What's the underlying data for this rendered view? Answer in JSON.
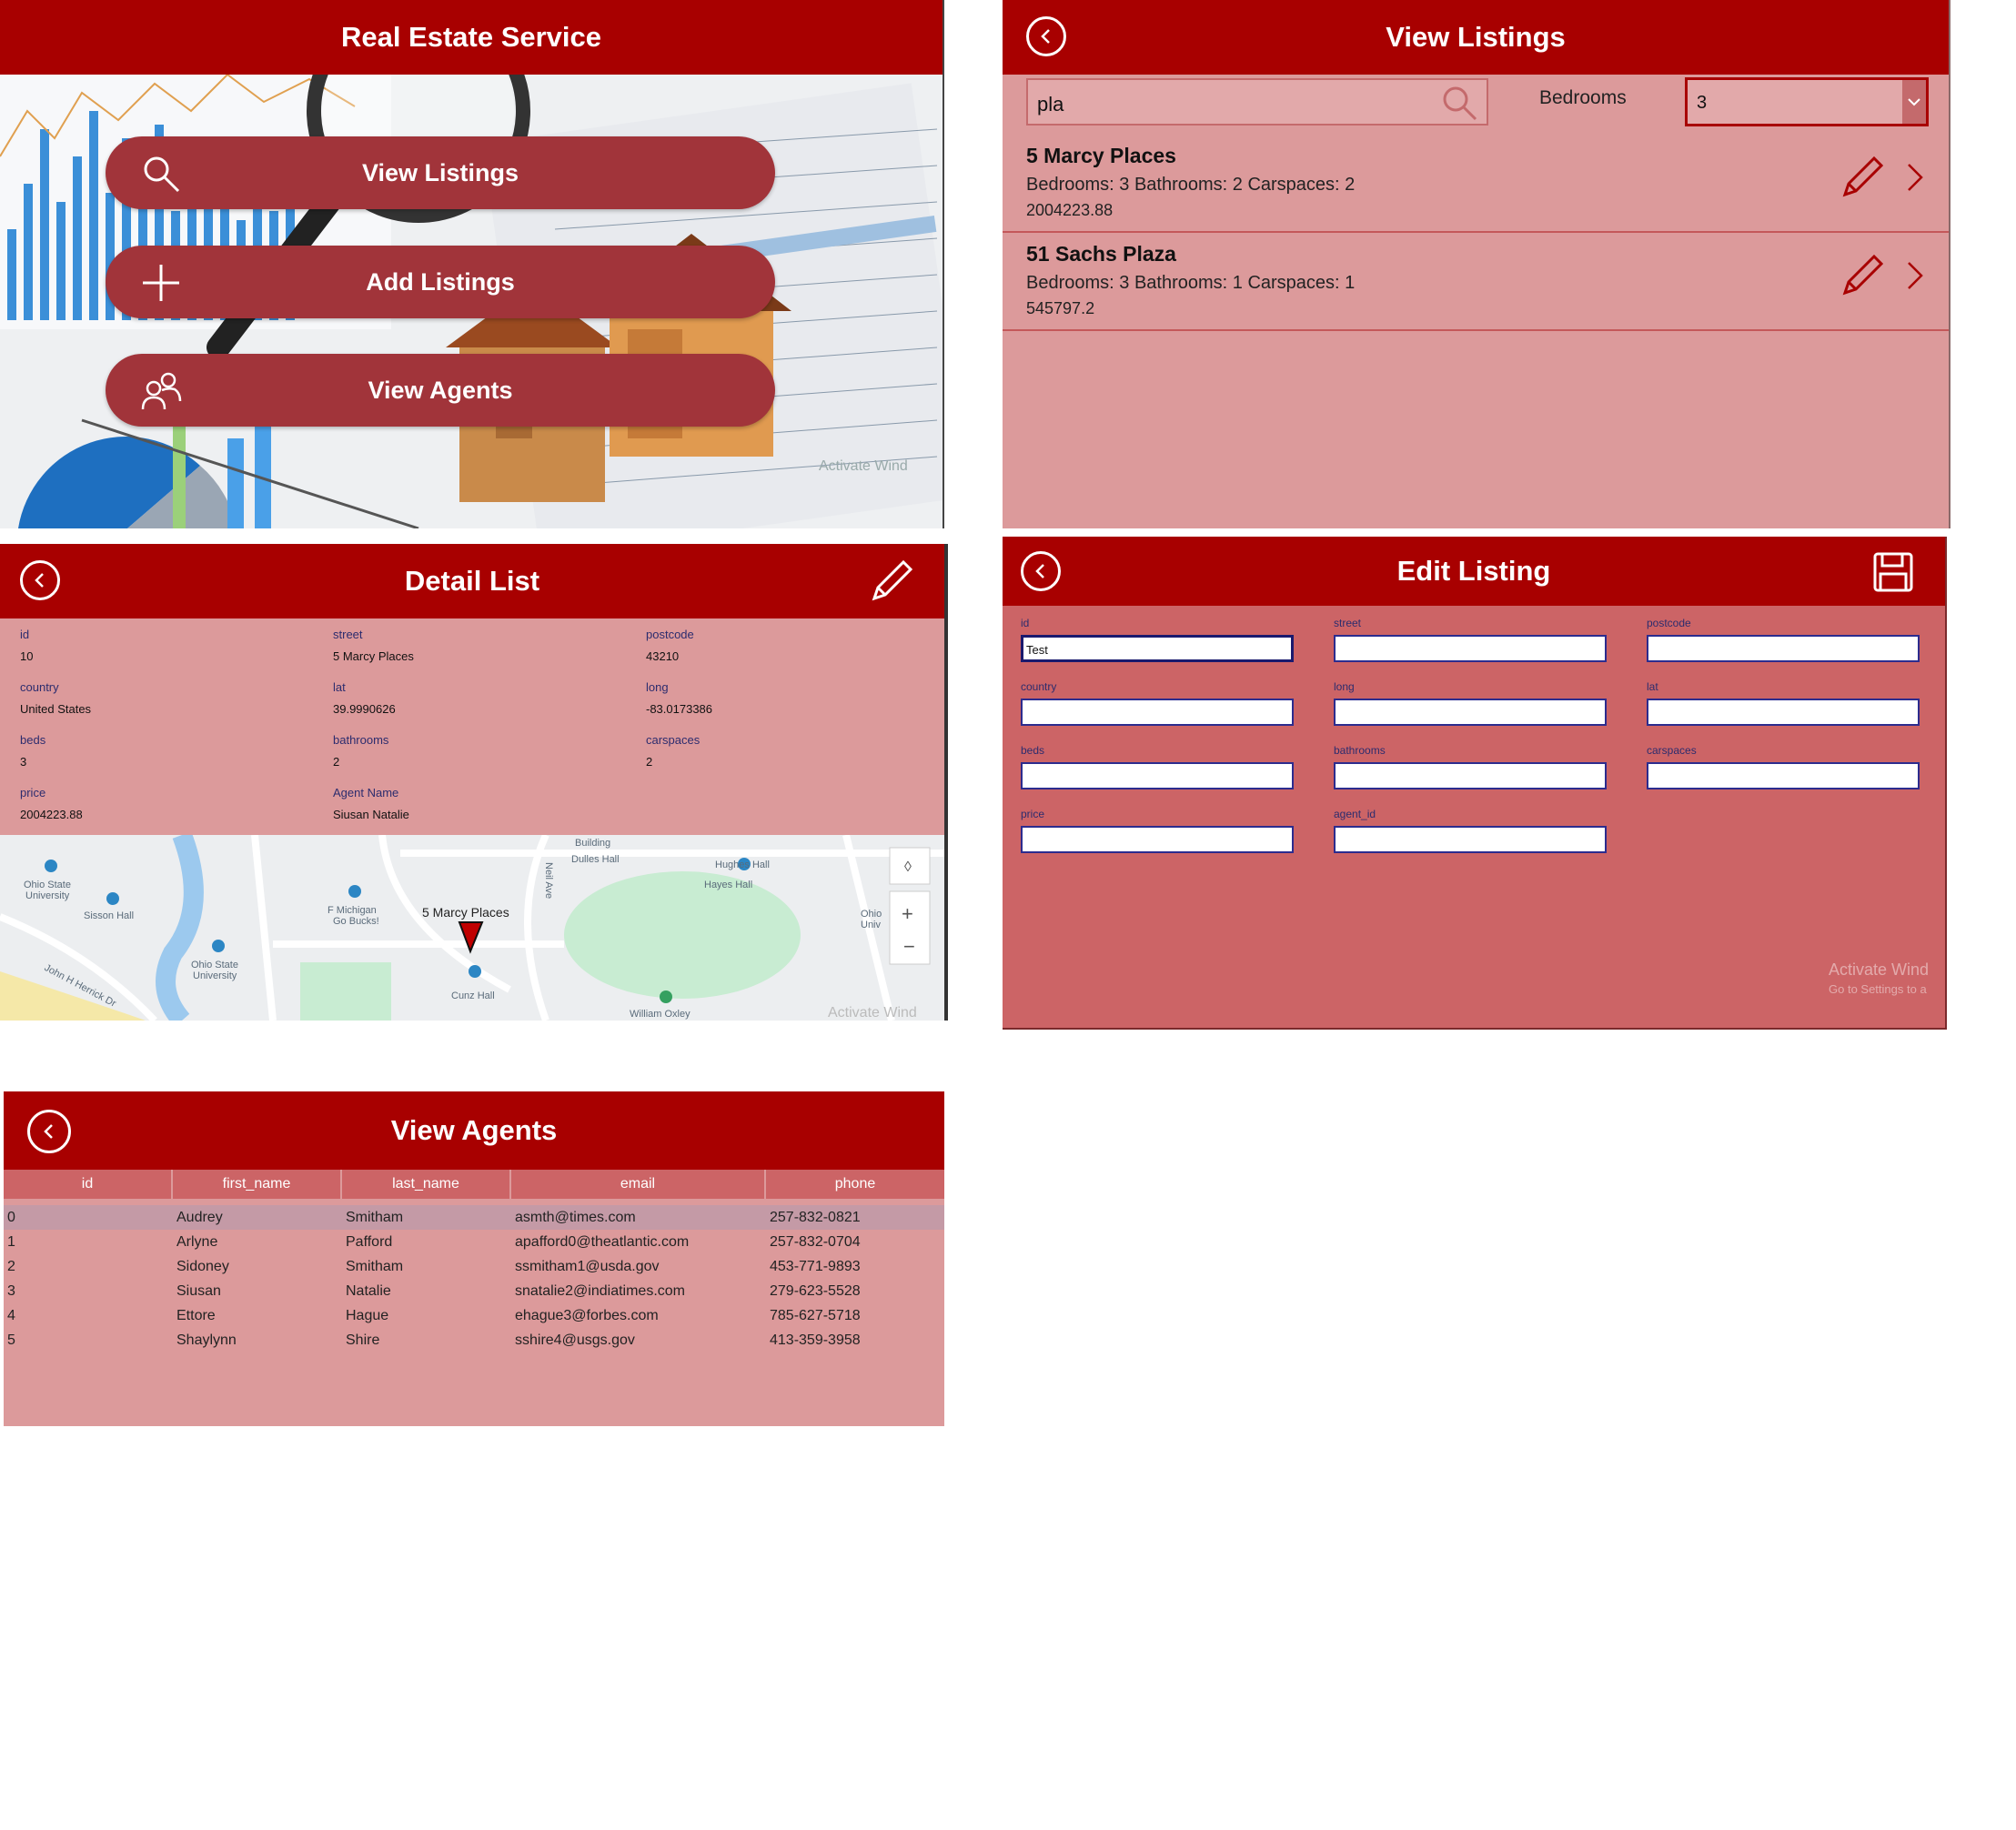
{
  "home": {
    "title": "Real Estate Service",
    "buttons": [
      {
        "label": "View Listings",
        "icon": "search-icon"
      },
      {
        "label": "Add Listings",
        "icon": "plus-icon"
      },
      {
        "label": "View Agents",
        "icon": "people-icon"
      }
    ]
  },
  "listings": {
    "title": "View Listings",
    "search": {
      "value": "pla"
    },
    "bedrooms_label": "Bedrooms",
    "bedrooms_value": "3",
    "items": [
      {
        "name": "5 Marcy Places",
        "details": "Bedrooms: 3 Bathrooms: 2 Carspaces: 2",
        "price": "2004223.88"
      },
      {
        "name": "51 Sachs Plaza",
        "details": "Bedrooms: 3 Bathrooms: 1 Carspaces: 1",
        "price": "545797.2"
      }
    ]
  },
  "detail": {
    "title": "Detail List",
    "fields": [
      {
        "label": "id",
        "value": "10"
      },
      {
        "label": "street",
        "value": "5 Marcy Places"
      },
      {
        "label": "postcode",
        "value": "43210"
      },
      {
        "label": "country",
        "value": "United States"
      },
      {
        "label": "lat",
        "value": "39.9990626"
      },
      {
        "label": "long",
        "value": "-83.0173386"
      },
      {
        "label": "beds",
        "value": "3"
      },
      {
        "label": "bathrooms",
        "value": "2"
      },
      {
        "label": "carspaces",
        "value": "2"
      },
      {
        "label": "price",
        "value": "2004223.88"
      },
      {
        "label": "Agent Name",
        "value": "Siusan Natalie"
      }
    ],
    "map": {
      "pin_label": "5 Marcy Places",
      "places": [
        "Ohio State University",
        "Sisson Hall",
        "Ohio State University",
        "F Michigan Go Bucks!",
        "Dulles Hall",
        "Hughes Hall",
        "Hayes Hall",
        "Cunz Hall",
        "William Oxley",
        "Building",
        "Ohio Univ"
      ],
      "streets": [
        "John H Herrick Dr",
        "Neil Ave"
      ]
    },
    "watermark": "Activate Wind"
  },
  "edit": {
    "title": "Edit Listing",
    "fields": [
      {
        "label": "id",
        "value": "Test"
      },
      {
        "label": "street",
        "value": ""
      },
      {
        "label": "postcode",
        "value": ""
      },
      {
        "label": "country",
        "value": ""
      },
      {
        "label": "long",
        "value": ""
      },
      {
        "label": "lat",
        "value": ""
      },
      {
        "label": "beds",
        "value": ""
      },
      {
        "label": "bathrooms",
        "value": ""
      },
      {
        "label": "carspaces",
        "value": ""
      },
      {
        "label": "price",
        "value": ""
      },
      {
        "label": "agent_id",
        "value": ""
      }
    ],
    "watermark": "Activate Wind",
    "watermark_sub": "Go to Settings to a"
  },
  "agents": {
    "title": "View Agents",
    "columns": [
      "id",
      "first_name",
      "last_name",
      "email",
      "phone"
    ],
    "rows": [
      [
        "0",
        "Audrey",
        "Smitham",
        "asmth@times.com",
        "257-832-0821"
      ],
      [
        "1",
        "Arlyne",
        "Pafford",
        "apafford0@theatlantic.com",
        "257-832-0704"
      ],
      [
        "2",
        "Sidoney",
        "Smitham",
        "ssmitham1@usda.gov",
        "453-771-9893"
      ],
      [
        "3",
        "Siusan",
        "Natalie",
        "snatalie2@indiatimes.com",
        "279-623-5528"
      ],
      [
        "4",
        "Ettore",
        "Hague",
        "ehague3@forbes.com",
        "785-627-5718"
      ],
      [
        "5",
        "Shaylynn",
        "Shire",
        "sshire4@usgs.gov",
        "413-359-3958"
      ]
    ]
  },
  "colors": {
    "header": "#a80000",
    "panel": "#dc9a9b",
    "button": "#a1343a",
    "edit_bg": "#cc6466"
  }
}
